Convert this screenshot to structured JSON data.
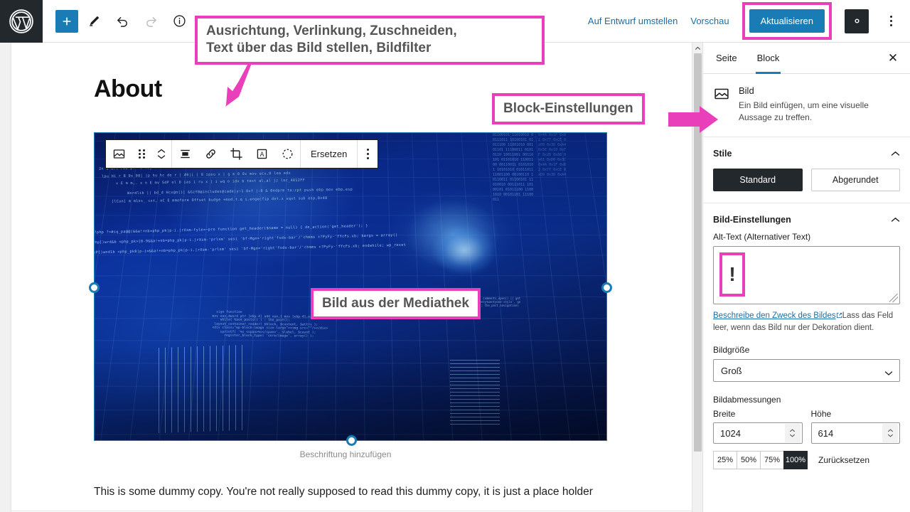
{
  "topbar": {
    "logo_icon": "wordpress-logo-icon",
    "add_block_label": "+",
    "tools": [
      {
        "name": "add-block-button",
        "icon": "plus-icon"
      },
      {
        "name": "edit-tool-button",
        "icon": "pencil-icon"
      },
      {
        "name": "undo-button",
        "icon": "undo-arrow-icon"
      },
      {
        "name": "redo-button",
        "icon": "redo-arrow-icon"
      },
      {
        "name": "details-button",
        "icon": "info-circle-icon"
      },
      {
        "name": "list-view-button",
        "icon": "list-view-icon"
      }
    ],
    "switch_to_draft": "Auf Entwurf umstellen",
    "preview": "Vorschau",
    "update": "Aktualisieren",
    "settings_icon": "gear-icon",
    "options_icon": "kebab-menu-icon"
  },
  "canvas": {
    "heading": "About",
    "caption_placeholder": "Beschriftung hinzufügen",
    "body_text": "This is some dummy copy. You're not really supposed to read this dummy copy, it is just a place holder"
  },
  "block_toolbar": {
    "items": [
      {
        "name": "block-type-image-button",
        "icon": "image-icon"
      },
      {
        "name": "drag-handle",
        "icon": "drag-dots-icon"
      },
      {
        "name": "move-updown-button",
        "icon": "chevron-up-down-icon"
      },
      {
        "name": "align-button",
        "icon": "align-icon"
      },
      {
        "name": "link-button",
        "icon": "link-icon"
      },
      {
        "name": "crop-button",
        "icon": "crop-icon"
      },
      {
        "name": "text-over-image-button",
        "icon": "text-over-image-icon"
      },
      {
        "name": "filter-button",
        "icon": "duotone-filter-icon"
      }
    ],
    "replace_label": "Ersetzen",
    "more_options_icon": "kebab-menu-icon"
  },
  "sidebar": {
    "tabs": [
      {
        "label": "Seite",
        "active": false
      },
      {
        "label": "Block",
        "active": true
      }
    ],
    "close_icon": "close-icon",
    "block_info": {
      "icon": "image-icon",
      "title": "Bild",
      "description": "Ein Bild einfügen, um eine visuelle Aussage zu treffen."
    },
    "styles": {
      "section_title": "Stile",
      "collapse_icon": "chevron-up-icon",
      "options": [
        {
          "label": "Standard",
          "selected": true
        },
        {
          "label": "Abgerundet",
          "selected": false
        }
      ]
    },
    "image_settings": {
      "section_title": "Bild-Einstellungen",
      "collapse_icon": "chevron-up-icon",
      "alt_label": "Alt-Text (Alternativer Text)",
      "alt_value": "!",
      "help_link": "Beschreibe den Zweck des Bildes",
      "help_link_icon": "external-link-icon",
      "help_text": "Lass das Feld leer, wenn das Bild nur der Dekoration dient.",
      "size_label": "Bildgröße",
      "size_value": "Groß",
      "size_chevron": "chevron-down-icon",
      "dimensions_label": "Bildabmessungen",
      "width_label": "Breite",
      "width_value": "1024",
      "height_label": "Höhe",
      "height_value": "614",
      "percent_options": [
        {
          "label": "25%",
          "active": false
        },
        {
          "label": "50%",
          "active": false
        },
        {
          "label": "75%",
          "active": false
        },
        {
          "label": "100%",
          "active": true
        }
      ],
      "reset_label": "Zurücksetzen"
    }
  },
  "annotations": {
    "toolbar_note": "Ausrichtung, Verlinkung, Zuschneiden,\nText über das Bild stellen, Bildfilter",
    "sidebar_note": "Block-Einstellungen",
    "image_note": "Bild aus der Mediathek"
  },
  "colors": {
    "accent_pink": "#ea3fbb",
    "wp_blue": "#1a7cb5",
    "dark": "#23282d"
  }
}
